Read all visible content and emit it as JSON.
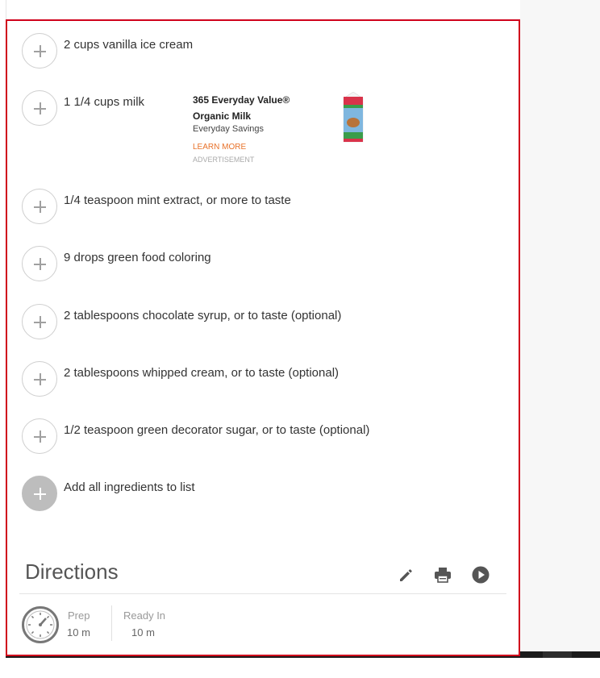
{
  "ingredients": [
    {
      "text": "2 cups vanilla ice cream"
    },
    {
      "text": "1 1/4 cups milk"
    },
    {
      "text": "1/4 teaspoon mint extract, or more to taste"
    },
    {
      "text": "9 drops green food coloring"
    },
    {
      "text": "2 tablespoons chocolate syrup, or to taste (optional)"
    },
    {
      "text": "2 tablespoons whipped cream, or to taste (optional)"
    },
    {
      "text": "1/2 teaspoon green decorator sugar, or to taste (optional)"
    }
  ],
  "add_all_label": "Add all ingredients to list",
  "ad": {
    "title": "365 Everyday Value® Organic Milk",
    "subtitle": "Everyday Savings",
    "learn_more": "LEARN MORE",
    "label": "ADVERTISEMENT"
  },
  "directions": {
    "title": "Directions",
    "prep_label": "Prep",
    "prep_value": "10 m",
    "ready_label": "Ready In",
    "ready_value": "10 m"
  },
  "icons": {
    "edit": "pencil-icon",
    "print": "printer-icon",
    "play": "play-icon",
    "timer": "timer-icon"
  },
  "colors": {
    "highlight_border": "#d0021b",
    "ad_link": "#e8722a"
  }
}
